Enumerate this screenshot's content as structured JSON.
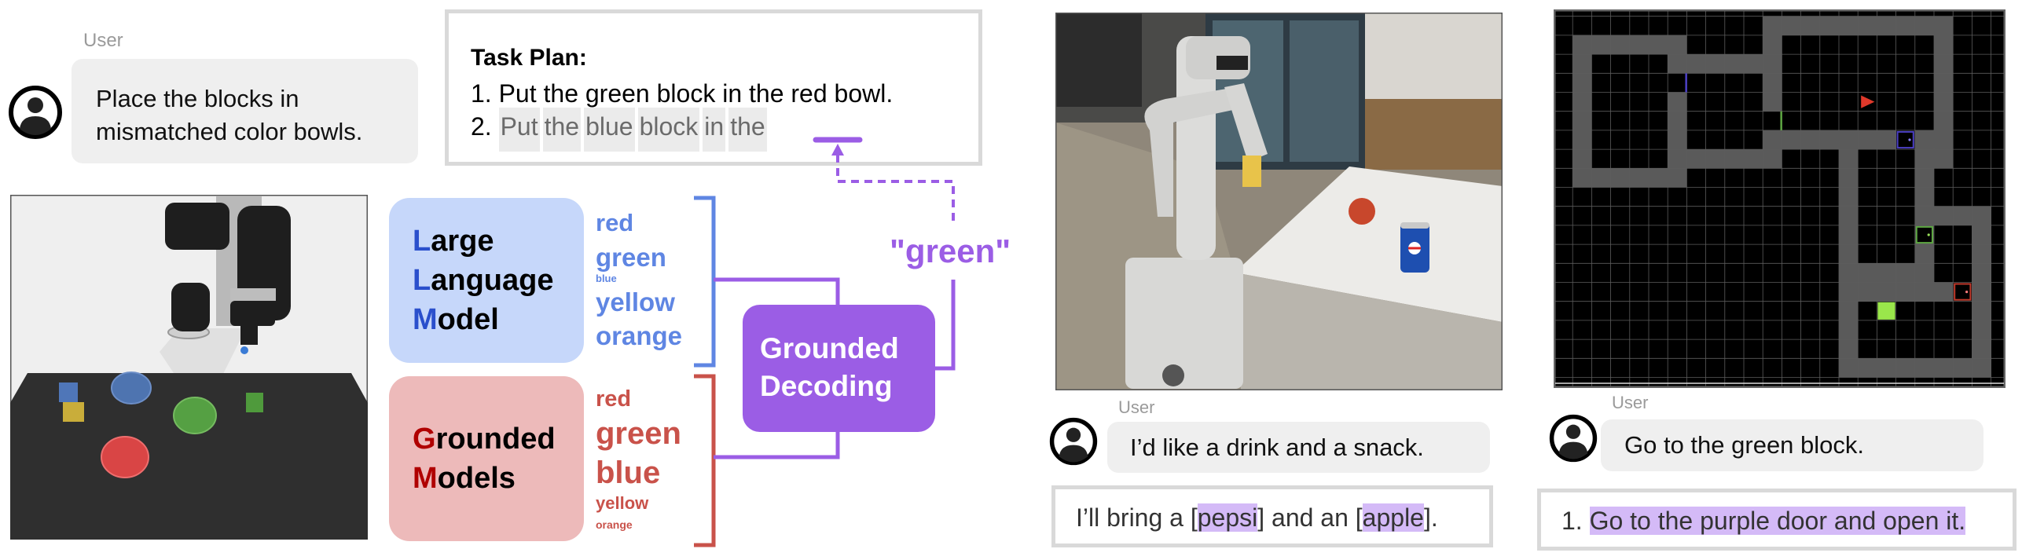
{
  "left_panel": {
    "user_label": "User",
    "user_message_lines": [
      "Place the blocks in",
      "mismatched color bowls."
    ],
    "task_plan": {
      "title": "Task Plan:",
      "line1": "1. Put the green block in the red bowl.",
      "line2_prefix": "2.",
      "line2_tokens": [
        "Put",
        "the",
        "blue",
        "block",
        "in",
        "the"
      ]
    },
    "llm": {
      "initials": [
        "L",
        "L",
        "M"
      ],
      "rests": [
        "arge",
        "anguage",
        "odel"
      ],
      "words": [
        "red",
        "green",
        "blue",
        "yellow",
        "orange"
      ]
    },
    "grounded_models": {
      "initials": [
        "G",
        "M"
      ],
      "rests": [
        "rounded",
        "odels"
      ],
      "words": [
        "red",
        "green",
        "blue",
        "yellow",
        "orange"
      ]
    },
    "decoder": {
      "lines": [
        "Grounded",
        "Decoding"
      ]
    },
    "selected_token": "\"green\""
  },
  "middle_panel": {
    "user_label": "User",
    "user_message": "I’d like a drink and a snack.",
    "response": {
      "parts": [
        "I’ll bring a [",
        "pepsi",
        "] and an [",
        "apple",
        "]."
      ]
    }
  },
  "right_panel": {
    "user_label": "User",
    "user_message": "Go to the green block.",
    "response": {
      "prefix": "1.",
      "highlight": "Go to the purple door and open it."
    }
  },
  "colors": {
    "llm_box": "#c6d7fa",
    "llm_word": "#5f86e3",
    "grounded_box": "#edbaba",
    "grounded_word": "#c9524a",
    "decoder": "#9b5de5",
    "highlight": "#d4baf7"
  },
  "icons": {
    "avatar": "user-avatar-icon",
    "arrow": "arrow-up-icon"
  }
}
